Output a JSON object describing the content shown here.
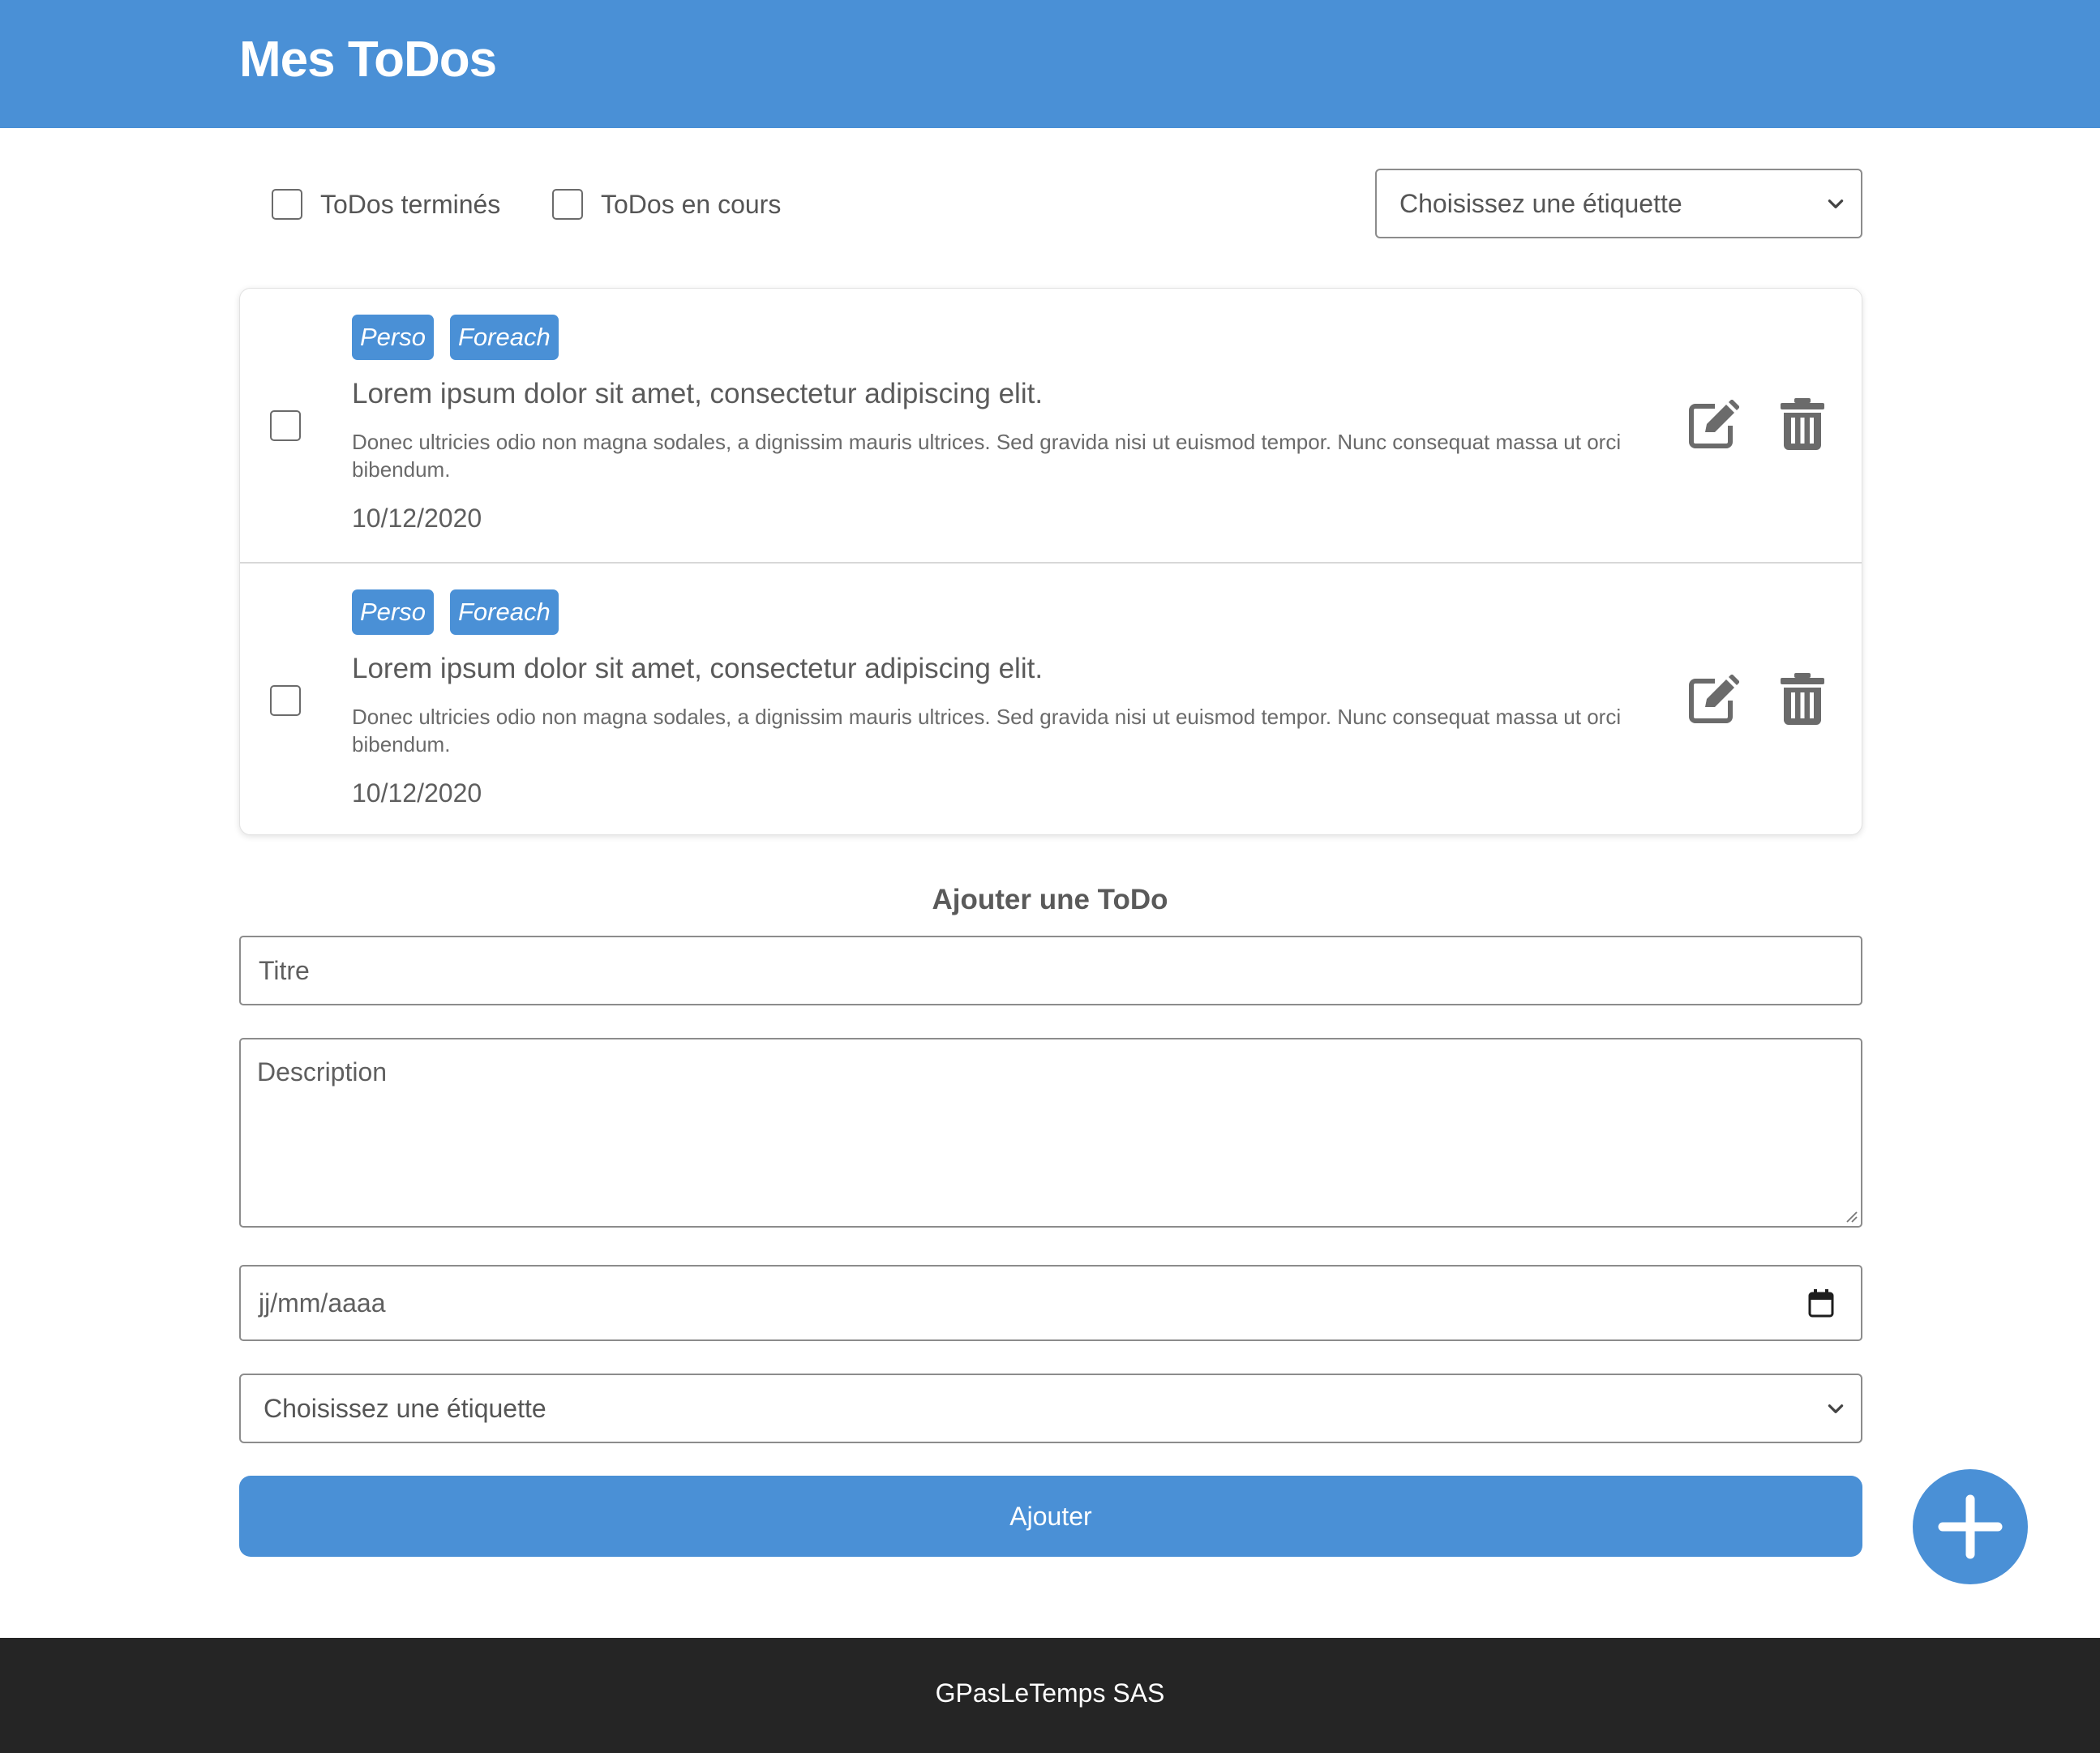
{
  "header": {
    "title": "Mes ToDos"
  },
  "filters": {
    "done_label": "ToDos terminés",
    "in_progress_label": "ToDos en cours",
    "tag_select": "Choisissez une étiquette"
  },
  "todos": [
    {
      "tags": [
        "Perso",
        "Foreach"
      ],
      "title": "Lorem ipsum dolor sit amet, consectetur adipiscing elit.",
      "description": "Donec ultricies odio non magna sodales, a dignissim mauris ultrices. Sed gravida nisi ut euismod tempor. Nunc consequat massa ut orci bibendum.",
      "date": "10/12/2020",
      "checked": false
    },
    {
      "tags": [
        "Perso",
        "Foreach"
      ],
      "title": "Lorem ipsum dolor sit amet, consectetur adipiscing elit.",
      "description": "Donec ultricies odio non magna sodales, a dignissim mauris ultrices. Sed gravida nisi ut euismod tempor. Nunc consequat massa ut orci bibendum.",
      "date": "10/12/2020",
      "checked": false
    }
  ],
  "form": {
    "heading": "Ajouter une ToDo",
    "title_placeholder": "Titre",
    "description_placeholder": "Description",
    "date_placeholder": "jj/mm/aaaa",
    "tag_select": "Choisissez une étiquette",
    "submit_label": "Ajouter"
  },
  "icons": {
    "edit": "edit-icon",
    "delete": "trash-icon",
    "calendar": "calendar-icon",
    "add": "plus-icon",
    "dropdown": "chevron-down-icon"
  },
  "colors": {
    "primary": "#4a90d6",
    "footer": "#252525",
    "text": "#5e5e5e"
  },
  "footer": {
    "text": "GPasLeTemps SAS"
  }
}
